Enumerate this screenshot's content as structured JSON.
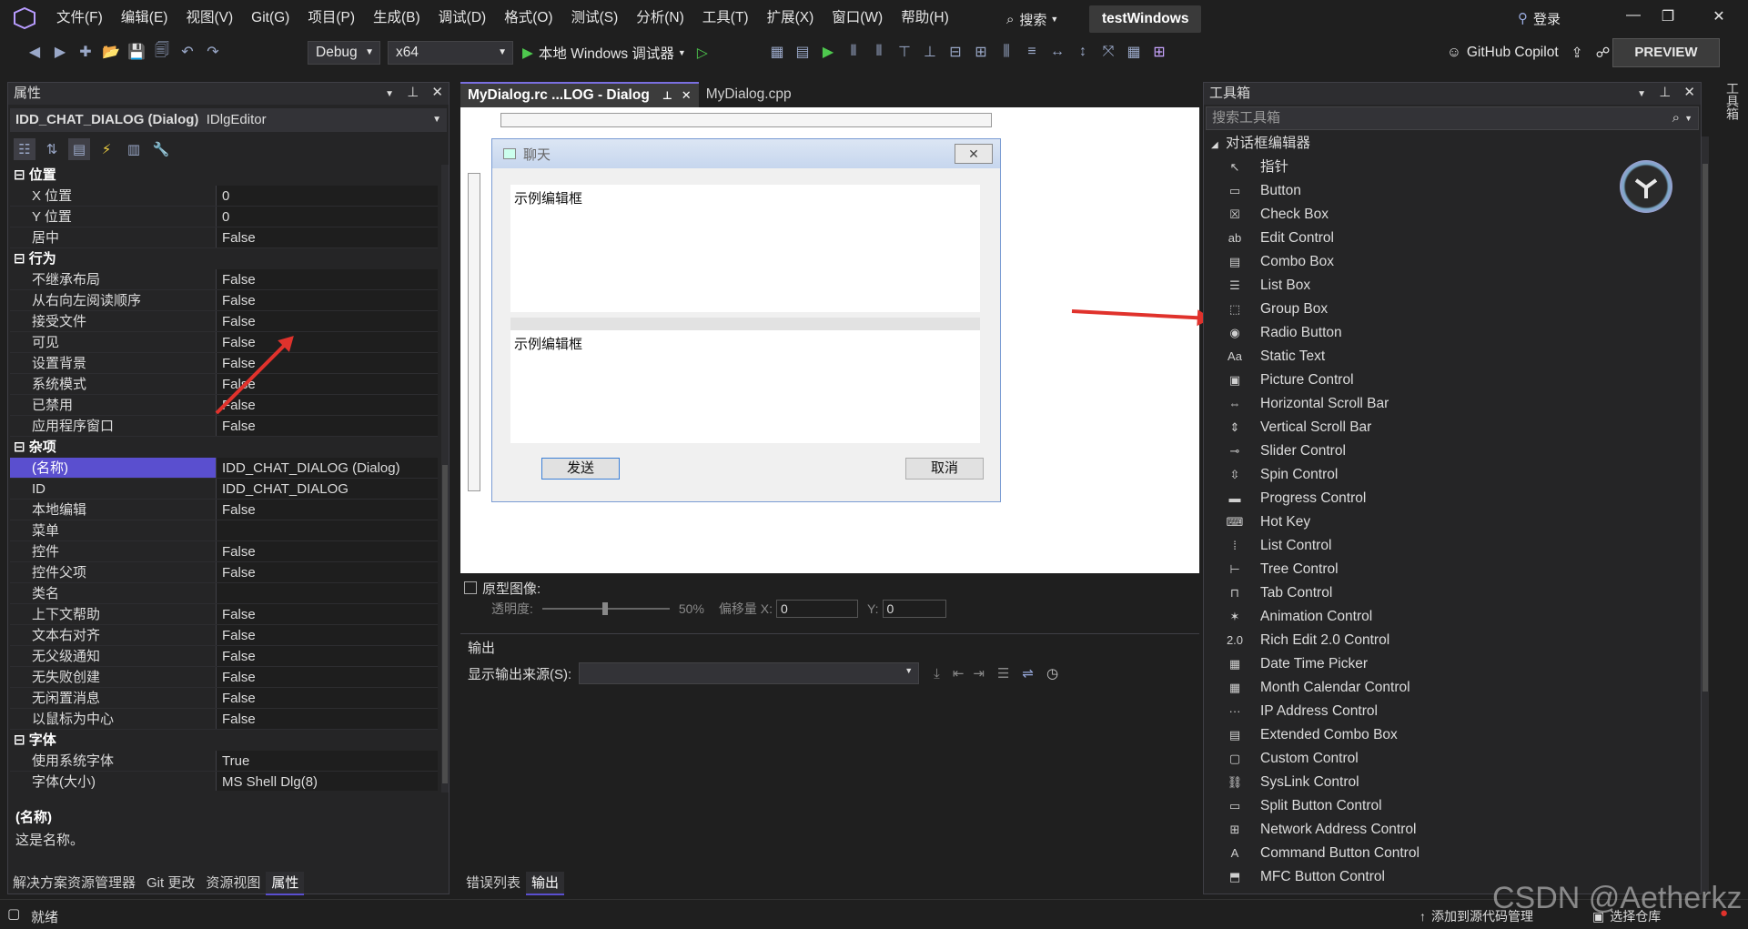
{
  "menubar": {
    "logo": "PRE",
    "items": [
      "文件(F)",
      "编辑(E)",
      "视图(V)",
      "Git(G)",
      "项目(P)",
      "生成(B)",
      "调试(D)",
      "格式(O)",
      "测试(S)",
      "分析(N)",
      "工具(T)",
      "扩展(X)",
      "窗口(W)",
      "帮助(H)"
    ],
    "search": "搜索",
    "solution": "testWindows",
    "login": "登录"
  },
  "toolbar": {
    "config": "Debug",
    "platform": "x64",
    "debugger": "本地 Windows 调试器",
    "copilot": "GitHub Copilot",
    "preview": "PREVIEW"
  },
  "properties": {
    "title": "属性",
    "object": "IDD_CHAT_DIALOG (Dialog)",
    "object_type": "IDlgEditor",
    "categories": [
      {
        "name": "位置",
        "rows": [
          [
            "X 位置",
            "0"
          ],
          [
            "Y 位置",
            "0"
          ],
          [
            "居中",
            "False"
          ]
        ]
      },
      {
        "name": "行为",
        "rows": [
          [
            "不继承布局",
            "False"
          ],
          [
            "从右向左阅读顺序",
            "False"
          ],
          [
            "接受文件",
            "False"
          ],
          [
            "可见",
            "False"
          ],
          [
            "设置背景",
            "False"
          ],
          [
            "系统模式",
            "False"
          ],
          [
            "已禁用",
            "False"
          ],
          [
            "应用程序窗口",
            "False"
          ]
        ]
      },
      {
        "name": "杂项",
        "rows": [
          [
            "(名称)",
            "IDD_CHAT_DIALOG (Dialog)"
          ],
          [
            "ID",
            "IDD_CHAT_DIALOG"
          ],
          [
            "本地编辑",
            "False"
          ],
          [
            "菜单",
            ""
          ],
          [
            "控件",
            "False"
          ],
          [
            "控件父项",
            "False"
          ],
          [
            "类名",
            ""
          ],
          [
            "上下文帮助",
            "False"
          ],
          [
            "文本右对齐",
            "False"
          ],
          [
            "无父级通知",
            "False"
          ],
          [
            "无失败创建",
            "False"
          ],
          [
            "无闲置消息",
            "False"
          ],
          [
            "以鼠标为中心",
            "False"
          ]
        ]
      },
      {
        "name": "字体",
        "rows": [
          [
            "使用系统字体",
            "True"
          ],
          [
            "字体(大小)",
            "MS Shell Dlg(8)"
          ]
        ]
      }
    ],
    "desc_title": "(名称)",
    "desc_text": "这是名称。",
    "bottom_tabs": [
      "解决方案资源管理器",
      "Git 更改",
      "资源视图",
      "属性"
    ]
  },
  "editor": {
    "tabs": [
      "MyDialog.rc ...LOG - Dialog",
      "MyDialog.cpp"
    ],
    "dialog_title": "聊天",
    "edit1": "示例编辑框",
    "edit2": "示例编辑框",
    "send": "发送",
    "cancel": "取消",
    "proto_label": "原型图像:",
    "opacity_label": "透明度:",
    "opacity_value": "50%",
    "offset_label": "偏移量 X:",
    "offset_x": "0",
    "y_label": "Y:",
    "offset_y": "0"
  },
  "output": {
    "title": "输出",
    "source_label": "显示输出来源(S):",
    "tabs": [
      "错误列表",
      "输出"
    ]
  },
  "toolbox": {
    "title": "工具箱",
    "search_placeholder": "搜索工具箱",
    "category": "对话框编辑器",
    "items": [
      {
        "label": "指针",
        "icon": "pointer-icon",
        "glyph": "↖"
      },
      {
        "label": "Button",
        "icon": "button-icon",
        "glyph": "▭"
      },
      {
        "label": "Check Box",
        "icon": "checkbox-icon",
        "glyph": "☒"
      },
      {
        "label": "Edit Control",
        "icon": "edit-control-icon",
        "glyph": "ab"
      },
      {
        "label": "Combo Box",
        "icon": "combo-box-icon",
        "glyph": "▤"
      },
      {
        "label": "List Box",
        "icon": "list-box-icon",
        "glyph": "☰"
      },
      {
        "label": "Group Box",
        "icon": "group-box-icon",
        "glyph": "⬚"
      },
      {
        "label": "Radio Button",
        "icon": "radio-button-icon",
        "glyph": "◉"
      },
      {
        "label": "Static Text",
        "icon": "static-text-icon",
        "glyph": "Aa"
      },
      {
        "label": "Picture Control",
        "icon": "picture-control-icon",
        "glyph": "▣"
      },
      {
        "label": "Horizontal Scroll Bar",
        "icon": "hscroll-icon",
        "glyph": "⇔"
      },
      {
        "label": "Vertical Scroll Bar",
        "icon": "vscroll-icon",
        "glyph": "⇕"
      },
      {
        "label": "Slider Control",
        "icon": "slider-icon",
        "glyph": "⊸"
      },
      {
        "label": "Spin Control",
        "icon": "spin-icon",
        "glyph": "⇳"
      },
      {
        "label": "Progress Control",
        "icon": "progress-icon",
        "glyph": "▬"
      },
      {
        "label": "Hot Key",
        "icon": "hotkey-icon",
        "glyph": "⌨"
      },
      {
        "label": "List Control",
        "icon": "list-control-icon",
        "glyph": "⁞"
      },
      {
        "label": "Tree Control",
        "icon": "tree-control-icon",
        "glyph": "⊢"
      },
      {
        "label": "Tab Control",
        "icon": "tab-control-icon",
        "glyph": "⊓"
      },
      {
        "label": "Animation Control",
        "icon": "animation-icon",
        "glyph": "✶"
      },
      {
        "label": "Rich Edit 2.0 Control",
        "icon": "rich-edit-icon",
        "glyph": "2.0"
      },
      {
        "label": "Date Time Picker",
        "icon": "date-time-icon",
        "glyph": "▦"
      },
      {
        "label": "Month Calendar Control",
        "icon": "calendar-icon",
        "glyph": "▦"
      },
      {
        "label": "IP Address Control",
        "icon": "ip-address-icon",
        "glyph": "···"
      },
      {
        "label": "Extended Combo Box",
        "icon": "ext-combo-icon",
        "glyph": "▤"
      },
      {
        "label": "Custom Control",
        "icon": "custom-control-icon",
        "glyph": "▢"
      },
      {
        "label": "SysLink Control",
        "icon": "syslink-icon",
        "glyph": "⛓"
      },
      {
        "label": "Split Button Control",
        "icon": "split-button-icon",
        "glyph": "▭"
      },
      {
        "label": "Network Address Control",
        "icon": "network-address-icon",
        "glyph": "⊞"
      },
      {
        "label": "Command Button Control",
        "icon": "command-button-icon",
        "glyph": "A"
      },
      {
        "label": "MFC Button Control",
        "icon": "mfc-button-icon",
        "glyph": "⬒"
      }
    ],
    "side_tab": "工具箱"
  },
  "status": {
    "ready": "就绪",
    "add_source": "添加到源代码管理",
    "select_repo": "选择仓库",
    "watermark": "CSDN @Aetherkz"
  },
  "colors": {
    "accent": "#5a4fcf",
    "arrow": "#e0322c"
  }
}
